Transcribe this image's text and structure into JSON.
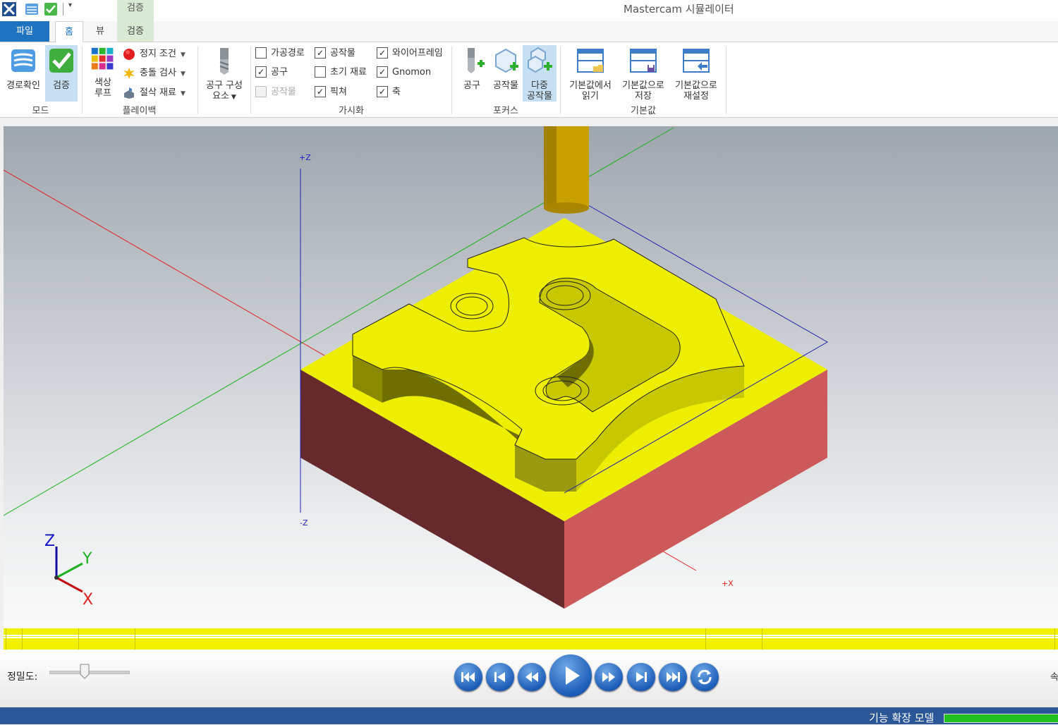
{
  "app": {
    "title": "Mastercam 시뮬레이터",
    "contextual_tab_group": "검증"
  },
  "tabs": {
    "file": "파일",
    "home": "홈",
    "view": "뷰",
    "verify": "검증"
  },
  "ribbon": {
    "mode": {
      "label": "모드",
      "backplot": "경로확인",
      "verify": "검증"
    },
    "playback": {
      "label": "플레이백",
      "color_loop_line1": "색상",
      "color_loop_line2": "루프",
      "stop_conditions": "정지 조건",
      "collision_check": "충돌 검사",
      "cut_stock": "절삭 재료"
    },
    "tool_components": {
      "line1": "공구 구성",
      "line2": "요소"
    },
    "visibility": {
      "label": "가시화",
      "items": [
        {
          "label": "가공경로",
          "checked": false,
          "enabled": true
        },
        {
          "label": "공구",
          "checked": true,
          "enabled": true
        },
        {
          "label": "공작물",
          "checked": false,
          "enabled": false
        },
        {
          "label": "공작물",
          "checked": true,
          "enabled": true
        },
        {
          "label": "초기 재료",
          "checked": false,
          "enabled": true
        },
        {
          "label": "픽쳐",
          "checked": true,
          "enabled": true
        },
        {
          "label": "와이어프레임",
          "checked": true,
          "enabled": true
        },
        {
          "label": "Gnomon",
          "checked": true,
          "enabled": true
        },
        {
          "label": "축",
          "checked": true,
          "enabled": true
        }
      ]
    },
    "focus": {
      "label": "포커스",
      "tool": "공구",
      "workpiece": "공작물",
      "multi_line1": "다중",
      "multi_line2": "공작물"
    },
    "defaults": {
      "label": "기본값",
      "load_line1": "기본값에서",
      "load_line2": "읽기",
      "save_line1": "기본값으로",
      "save_line2": "저장",
      "reset_line1": "기본값으로",
      "reset_line2": "재설정"
    }
  },
  "viewport": {
    "axis_pz": "+Z",
    "axis_nz": "-Z",
    "axis_px": "+X",
    "gnomon_x": "X",
    "gnomon_y": "Y",
    "gnomon_z": "Z"
  },
  "playback_bar": {
    "accuracy_label": "정밀도:",
    "accuracy_value": 0.45,
    "speed_label_fragment": "속"
  },
  "status": {
    "text": "기능 확장 모델",
    "progress": 1.0
  },
  "colors": {
    "accent_blue": "#1f74c2",
    "stock_yellow": "#eeee00",
    "stock_side_dark": "#662a2d",
    "stock_side_light": "#cd5a5a",
    "tool_gold": "#c8a000",
    "status_bar": "#2b5797",
    "progress_green": "#21c021"
  }
}
